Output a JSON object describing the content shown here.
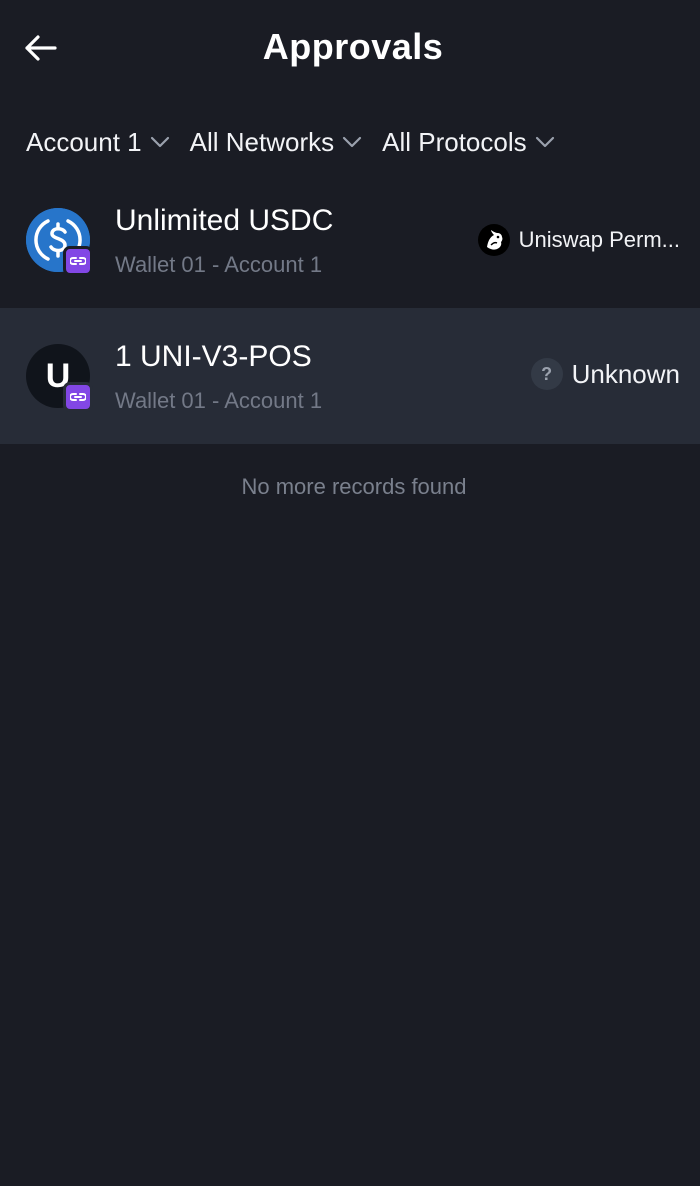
{
  "header": {
    "title": "Approvals",
    "back_icon": "arrow-left-icon"
  },
  "filters": [
    {
      "label": "Account 1",
      "icon": "chevron-down-icon"
    },
    {
      "label": "All Networks",
      "icon": "chevron-down-icon"
    },
    {
      "label": "All Protocols",
      "icon": "chevron-down-icon"
    }
  ],
  "approvals": [
    {
      "title": "Unlimited USDC",
      "subtitle": "Wallet 01 - Account 1",
      "token_icon": "usdc-icon",
      "network_icon": "polygon-icon",
      "protocol": "Uniswap Perm...",
      "protocol_icon": "uniswap-icon"
    },
    {
      "title": "1 UNI-V3-POS",
      "subtitle": "Wallet 01 - Account 1",
      "token_letter": "U",
      "network_icon": "polygon-icon",
      "protocol": "Unknown",
      "protocol_icon": "question-icon",
      "protocol_icon_glyph": "?"
    }
  ],
  "footer": {
    "no_more_text": "No more records found"
  },
  "colors": {
    "background": "#1a1c24",
    "highlight_row": "#272c37",
    "usdc_blue": "#2775ca",
    "polygon_purple": "#8247e5",
    "muted_text": "#737987"
  }
}
